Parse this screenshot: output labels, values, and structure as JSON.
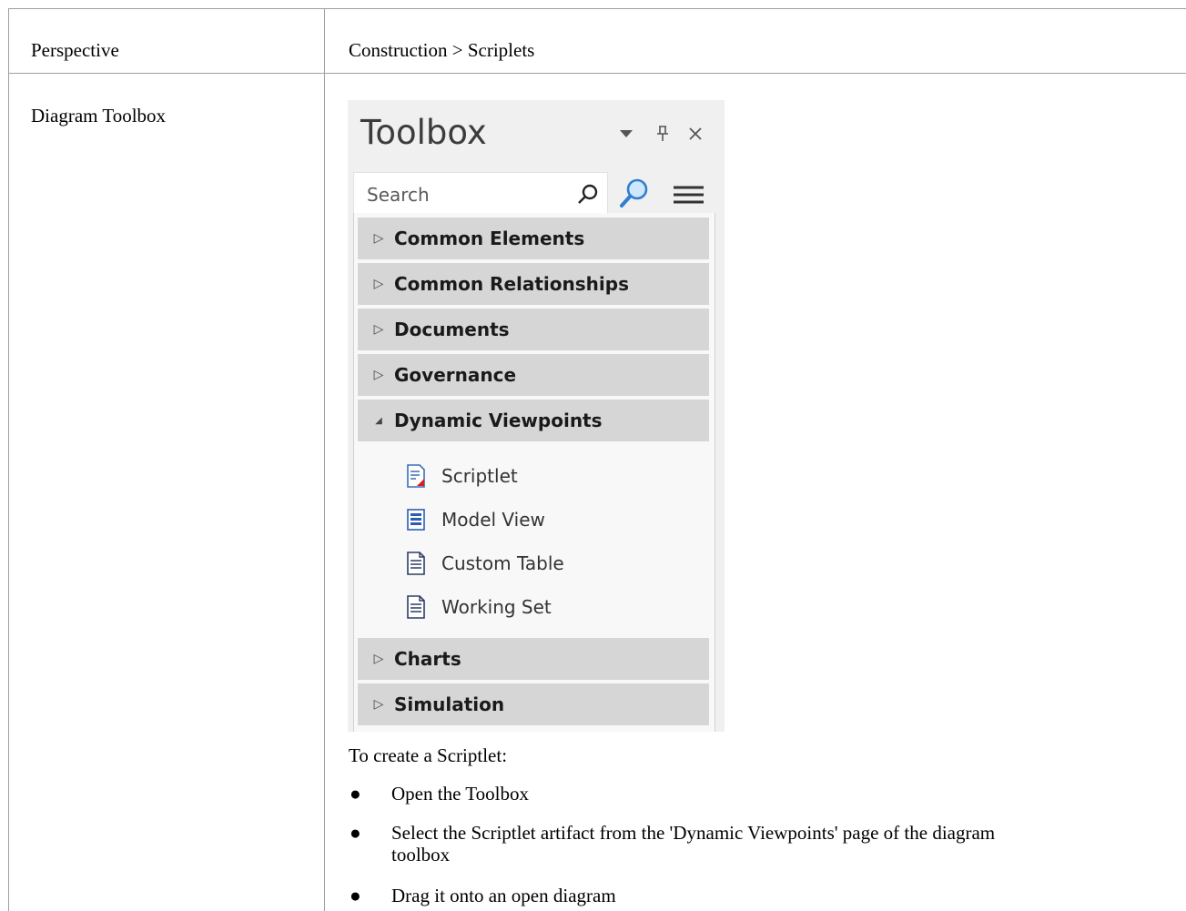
{
  "table": {
    "rows": [
      {
        "label": "Perspective",
        "value": "Construction > Scriplets"
      },
      {
        "label": "Diagram Toolbox"
      }
    ]
  },
  "toolbox": {
    "title": "Toolbox",
    "search_placeholder": "Search",
    "sections_top": [
      {
        "label": "Common Elements",
        "expanded": false
      },
      {
        "label": "Common Relationships",
        "expanded": false
      },
      {
        "label": "Documents",
        "expanded": false
      },
      {
        "label": "Governance",
        "expanded": false
      },
      {
        "label": "Dynamic Viewpoints",
        "expanded": true
      }
    ],
    "items": [
      {
        "label": "Scriptlet",
        "icon": "scriptlet-icon"
      },
      {
        "label": "Model View",
        "icon": "model-view-icon"
      },
      {
        "label": "Custom Table",
        "icon": "document-icon"
      },
      {
        "label": "Working Set",
        "icon": "document-icon"
      }
    ],
    "sections_bottom": [
      {
        "label": "Charts",
        "expanded": false
      },
      {
        "label": "Simulation",
        "expanded": false
      }
    ],
    "collapsed_arrow": "▷",
    "expanded_arrow": "◢"
  },
  "instructions": {
    "intro": "To create a Scriptlet:",
    "bullets": [
      "Open the Toolbox",
      "Select the Scriptlet artifact from the 'Dynamic Viewpoints' page of the diagram",
      "toolbox",
      "Drag it onto an open diagram"
    ]
  },
  "colors": {
    "border": "#a0a0a0",
    "section_bg": "#d6d6d6",
    "panel_bg": "#f0f0f0"
  }
}
